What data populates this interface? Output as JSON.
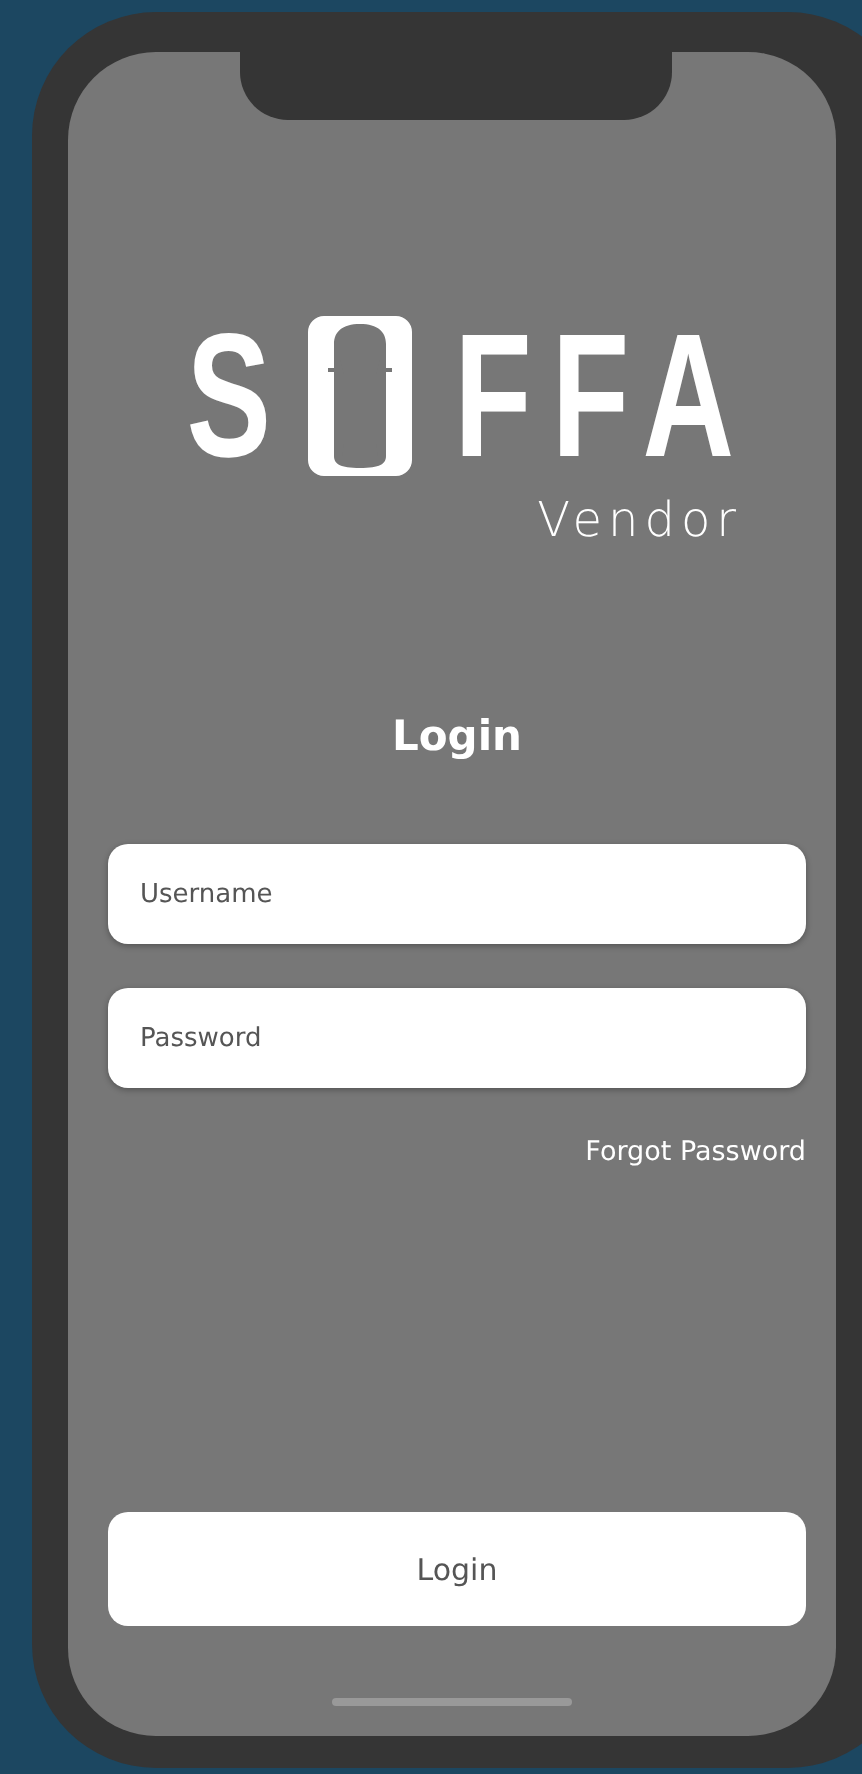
{
  "logo": {
    "before_o": "S",
    "after_o": "FFA",
    "subtitle": "Vendor"
  },
  "title": "Login",
  "fields": [
    {
      "placeholder": "Username"
    },
    {
      "placeholder": "Password"
    }
  ],
  "forgot_link": "Forgot Password",
  "login_button": "Login"
}
